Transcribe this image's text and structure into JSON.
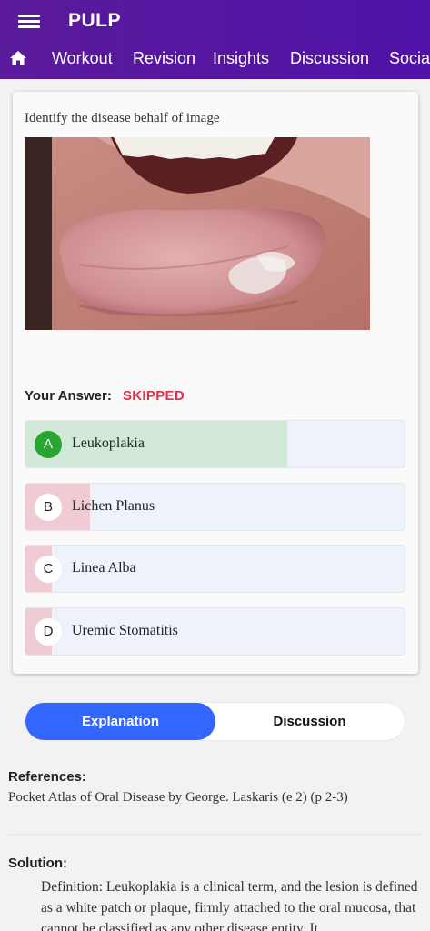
{
  "app": {
    "title": "PULP"
  },
  "nav": {
    "tabs": [
      {
        "label": "Workout"
      },
      {
        "label": "Revision"
      },
      {
        "label": "Insights"
      },
      {
        "label": "Discussion"
      },
      {
        "label": "Social"
      }
    ]
  },
  "question": {
    "text": "Identify the disease behalf of image",
    "image": "tongue-lesion-photo"
  },
  "answer": {
    "label": "Your Answer:",
    "value": "SKIPPED"
  },
  "options": [
    {
      "letter": "A",
      "text": "Leukoplakia",
      "correct": true,
      "response_share": 0.69
    },
    {
      "letter": "B",
      "text": "Lichen Planus",
      "correct": false,
      "response_share": 0.17
    },
    {
      "letter": "C",
      "text": "Linea Alba",
      "correct": false,
      "response_share": 0.07
    },
    {
      "letter": "D",
      "text": "Uremic Stomatitis",
      "correct": false,
      "response_share": 0.07
    }
  ],
  "tabs": {
    "explanation": "Explanation",
    "discussion": "Discussion",
    "active": "explanation"
  },
  "references": {
    "title": "References:",
    "text": "Pocket Atlas of Oral Disease by George. Laskaris (e 2) (p 2-3)"
  },
  "solution": {
    "title": "Solution:",
    "text": "Definition: Leukoplakia is a clinical term, and the lesion is defined as a white patch or plaque, firmly attached to the oral mucosa, that cannot be classified as any other disease entity. It"
  },
  "colors": {
    "primary": "#5b1a9c",
    "accent": "#3366ff",
    "skipped": "#e0304a",
    "correct": "#29a62f"
  }
}
